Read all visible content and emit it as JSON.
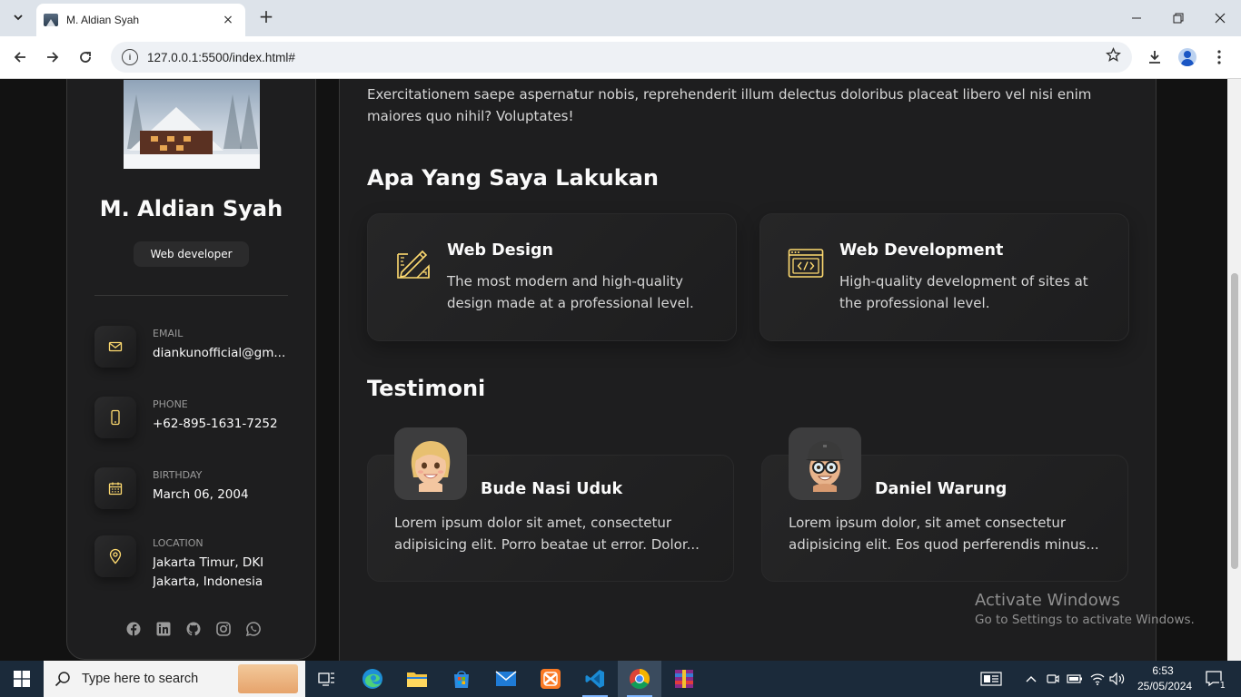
{
  "browser": {
    "tab_title": "M. Aldian Syah",
    "url": "127.0.0.1:5500/index.html#",
    "new_tab_symbol": "+",
    "close_symbol": "×"
  },
  "sidebar": {
    "name": "M. Aldian Syah",
    "role": "Web developer",
    "contacts": [
      {
        "label": "Email",
        "value": "diankunofficial@gm...",
        "icon": "mail-icon"
      },
      {
        "label": "Phone",
        "value": "+62-895-1631-7252",
        "icon": "phone-icon"
      },
      {
        "label": "Birthday",
        "value": "March 06, 2004",
        "icon": "calendar-icon"
      },
      {
        "label": "Location",
        "value": "Jakarta Timur, DKI Jakarta, Indonesia",
        "icon": "location-pin-icon"
      }
    ],
    "socials": [
      "facebook-icon",
      "linkedin-icon",
      "github-icon",
      "instagram-icon",
      "whatsapp-icon"
    ]
  },
  "main": {
    "about_text": "Exercitationem saepe aspernatur nobis, reprehenderit illum delectus doloribus placeat libero vel nisi enim maiores quo nihil? Voluptates!",
    "services_title": "Apa Yang Saya Lakukan",
    "services": [
      {
        "title": "Web Design",
        "desc": "The most modern and high-quality design made at a professional level.",
        "icon": "design-icon"
      },
      {
        "title": "Web Development",
        "desc": "High-quality development of sites at the professional level.",
        "icon": "code-icon"
      }
    ],
    "testimonials_title": "Testimoni",
    "testimonials": [
      {
        "name": "Bude Nasi Uduk",
        "line1": "Lorem ipsum dolor sit amet, consectetur",
        "line2": "adipisicing elit. Porro beatae ut error. Dolor..."
      },
      {
        "name": "Daniel Warung",
        "line1": "Lorem ipsum dolor, sit amet consectetur",
        "line2": "adipisicing elit. Eos quod perferendis minus..."
      }
    ]
  },
  "watermark": {
    "line1": "Activate Windows",
    "line2": "Go to Settings to activate Windows."
  },
  "taskbar": {
    "search_placeholder": "Type here to search",
    "time": "6:53",
    "date": "25/05/2024",
    "notification_count": "1"
  },
  "colors": {
    "accent": "#ffdb70",
    "background": "#121212",
    "card": "#1e1e1f"
  }
}
